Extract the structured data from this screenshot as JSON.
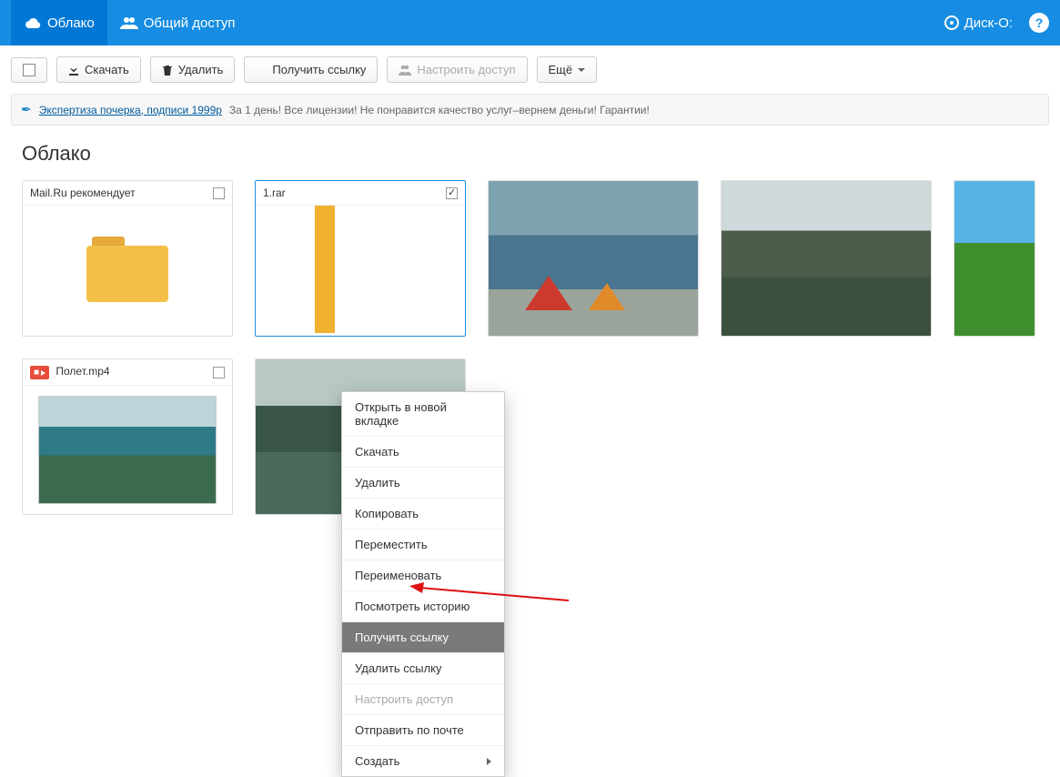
{
  "topbar": {
    "cloud_label": "Облако",
    "shared_label": "Общий доступ",
    "disk_label": "Диск-О:"
  },
  "toolbar": {
    "download": "Скачать",
    "delete": "Удалить",
    "get_link": "Получить ссылку",
    "share_access": "Настроить доступ",
    "more": "Ещё"
  },
  "ad": {
    "link_text": "Экспертиза почерка, подписи 1999р",
    "tail": "За 1 день! Все лицензии! Не понравится качество услуг–вернем деньги! Гарантии!"
  },
  "page_title": "Облако",
  "cards": {
    "recommend": "Mail.Ru рекомендует",
    "rar": "1.rar",
    "video": "Полет.mp4"
  },
  "context_menu": {
    "open_new_tab": "Открыть в новой вкладке",
    "download": "Скачать",
    "delete": "Удалить",
    "copy": "Копировать",
    "move": "Переместить",
    "rename": "Переименовать",
    "history": "Посмотреть историю",
    "get_link": "Получить ссылку",
    "remove_link": "Удалить ссылку",
    "share_access": "Настроить доступ",
    "send_mail": "Отправить по почте",
    "create": "Создать"
  }
}
